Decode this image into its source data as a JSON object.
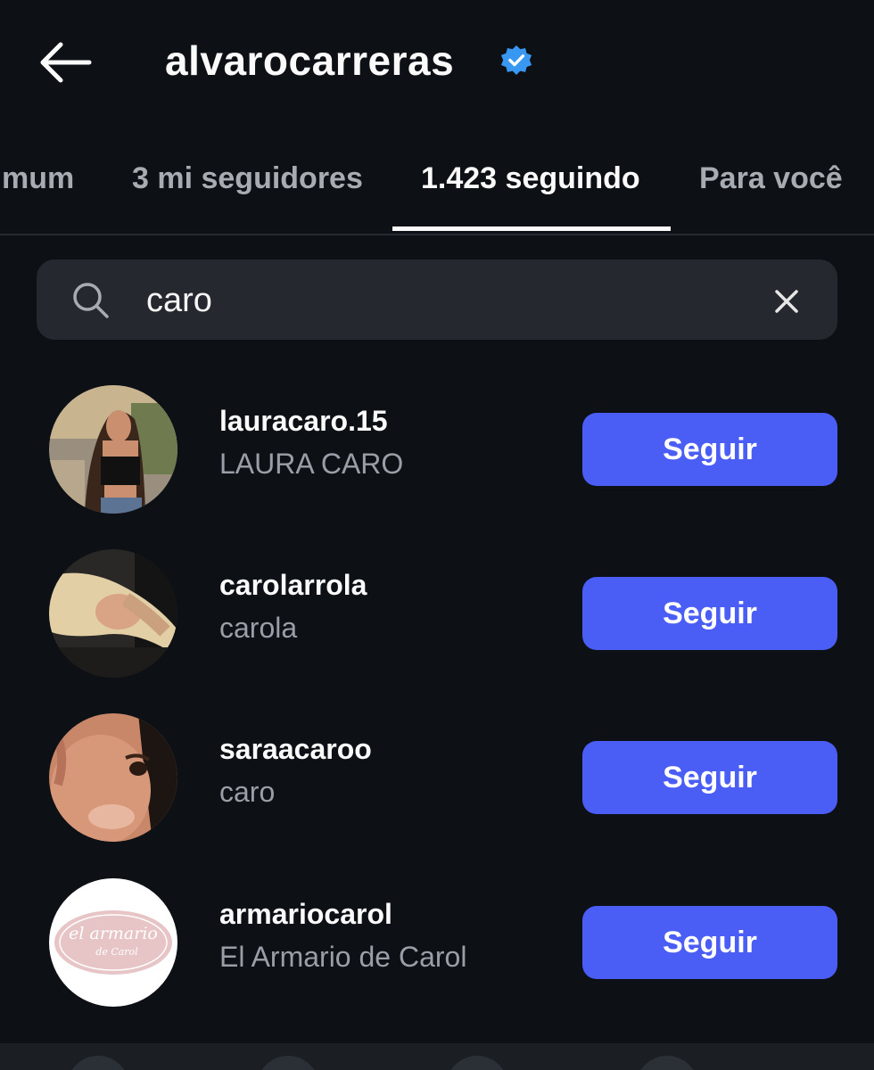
{
  "header": {
    "back_icon": "arrow-left-icon",
    "title": "alvarocarreras",
    "verified_icon": "verified-badge-icon",
    "verified_color": "#3897f0"
  },
  "tabs": [
    {
      "label": "mum",
      "active": false
    },
    {
      "label": "3 mi seguidores",
      "active": false
    },
    {
      "label": "1.423 seguindo",
      "active": true
    },
    {
      "label": "Para você",
      "active": false
    }
  ],
  "search": {
    "icon": "search-icon",
    "value": "caro",
    "clear_icon": "close-icon"
  },
  "results": [
    {
      "username": "lauracaro.15",
      "full_name": "LAURA CARO",
      "button": "Seguir"
    },
    {
      "username": "carolarrola",
      "full_name": "carola",
      "button": "Seguir"
    },
    {
      "username": "saraacaroo",
      "full_name": "caro",
      "button": "Seguir"
    },
    {
      "username": "armariocarol",
      "full_name": "El Armario de Carol",
      "button": "Seguir",
      "avatar_logo_text": "el armario de Carol"
    }
  ],
  "colors": {
    "background": "#0d1015",
    "search_background": "#25282e",
    "button": "#4a5df5",
    "secondary_text": "#9a9ea6",
    "inactive_tab": "#a7abb2"
  }
}
